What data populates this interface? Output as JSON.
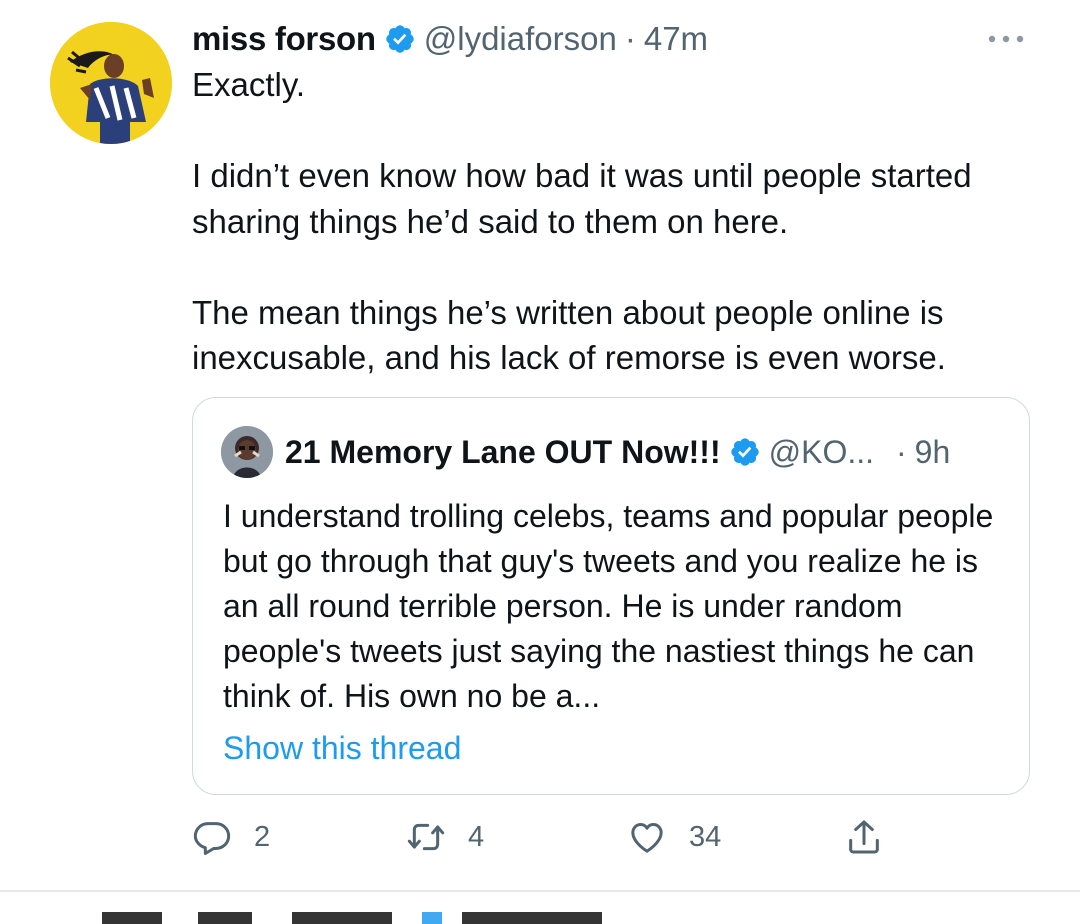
{
  "tweet": {
    "display_name": "miss forson",
    "handle": "@lydiaforson",
    "separator": "·",
    "time": "47m",
    "paragraphs": [
      "Exactly.",
      "I didn’t even know how bad it was until people started sharing things he’d said to them on here.",
      "The mean things he’s written about people online is inexcusable, and his lack of remorse is even worse."
    ],
    "avatar_icon": "user-avatar-photo",
    "verified_icon": "verified-badge-icon",
    "more_icon": "more-horizontal-icon"
  },
  "quote": {
    "display_name": "21 Memory Lane OUT Now!!!",
    "handle": "@KO...",
    "separator": "·",
    "time": "9h",
    "text": "I understand trolling celebs, teams and popular people but go through that guy's tweets and you realize he is an all round terrible person. He is under random people's tweets just saying the nastiest things he can think of. His own no be a...",
    "show_thread": "Show this thread"
  },
  "actions": {
    "reply_count": "2",
    "retweet_count": "4",
    "like_count": "34"
  },
  "colors": {
    "text": "#0f1419",
    "secondary": "#536471",
    "link": "#1d9bf0",
    "verified": "#1d9bf0",
    "border": "#cfd9de",
    "avatar_bg": "#f2d21f"
  }
}
